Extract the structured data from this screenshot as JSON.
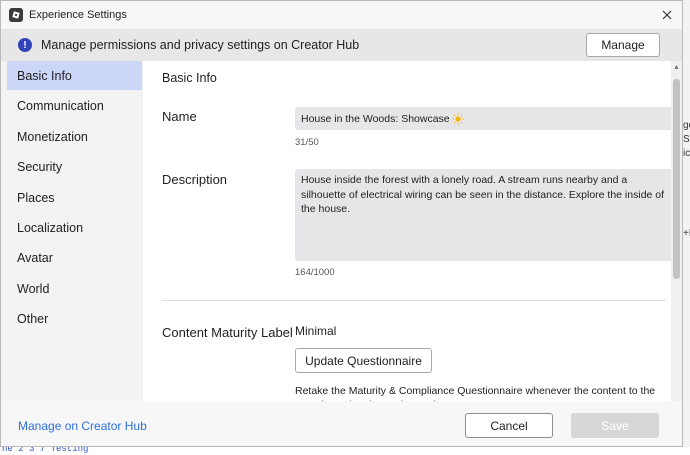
{
  "window": {
    "title": "Experience Settings"
  },
  "banner": {
    "text": "Manage permissions and privacy settings on Creator Hub",
    "button_label": "Manage"
  },
  "sidebar": {
    "items": [
      {
        "label": "Basic Info",
        "active": true
      },
      {
        "label": "Communication",
        "active": false
      },
      {
        "label": "Monetization",
        "active": false
      },
      {
        "label": "Security",
        "active": false
      },
      {
        "label": "Places",
        "active": false
      },
      {
        "label": "Localization",
        "active": false
      },
      {
        "label": "Avatar",
        "active": false
      },
      {
        "label": "World",
        "active": false
      },
      {
        "label": "Other",
        "active": false
      }
    ]
  },
  "content": {
    "section_title": "Basic Info",
    "name": {
      "label": "Name",
      "value": "House in the Woods: Showcase",
      "counter": "31/50"
    },
    "description": {
      "label": "Description",
      "value": "House inside the forest with a lonely road. A stream runs nearby and a silhouette of electrical wiring can be seen in the distance. Explore the inside of the house.",
      "counter": "164/1000"
    },
    "maturity": {
      "label": "Content Maturity Label",
      "value": "Minimal",
      "button_label": "Update Questionnaire",
      "help_text": "Retake the Maturity & Compliance Questionnaire whenever the content to the experience has been changed"
    }
  },
  "footer": {
    "link_label": "Manage on Creator Hub",
    "cancel_label": "Cancel",
    "save_label": "Save"
  },
  "colors": {
    "accent_selected": "#cbd6f8",
    "link": "#2f6fe0",
    "info_icon": "#3344bb",
    "field_bg": "#e6e6e8"
  },
  "icons": {
    "app": "studio-app-icon",
    "close": "close-icon",
    "info": "info-icon",
    "sun": "sun-emoji-icon"
  }
}
